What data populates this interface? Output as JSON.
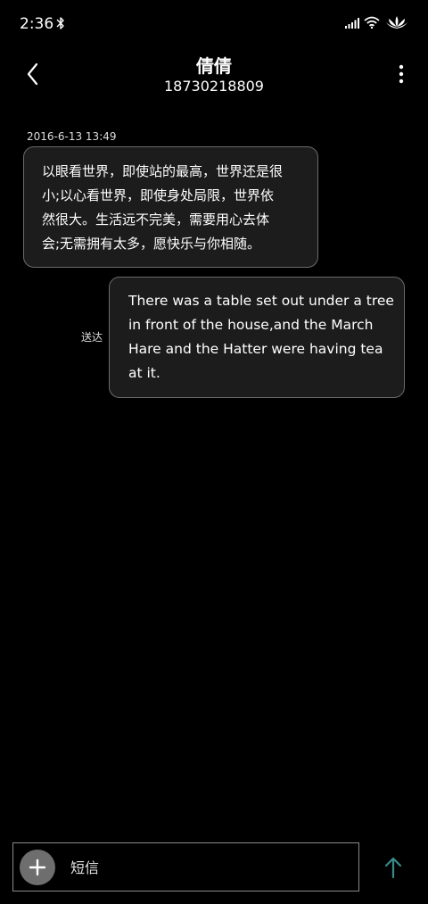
{
  "status_bar": {
    "time": "2:36",
    "icons": [
      "bluetooth-icon",
      "signal-icon",
      "wifi-icon",
      "lotus-icon"
    ]
  },
  "header": {
    "contact_name": "倩倩",
    "contact_number": "18730218809",
    "back_icon": "chevron-left-icon",
    "more_icon": "more-vertical-icon"
  },
  "conversation": {
    "timestamp": "2016-6-13 13:49",
    "messages": [
      {
        "direction": "incoming",
        "text": "以眼看世界，即使站的最高，世界还是很\n小;以心看世界，即使身处局限，世界依\n然很大。生活远不完美，需要用心去体\n会;无需拥有太多，愿快乐与你相随。"
      },
      {
        "direction": "outgoing",
        "text": "There was a table set out under a tree\nin front of the house,and the March\nHare and the Hatter were having tea\nat it.",
        "status": "送达"
      }
    ]
  },
  "composer": {
    "placeholder": "短信",
    "value": "",
    "add_icon": "plus-icon",
    "send_icon": "arrow-up-icon"
  },
  "colors": {
    "background": "#000000",
    "bubble_fill": "#1c1c1c",
    "bubble_border": "#6b6b6b",
    "send_accent": "#3a8a8a",
    "add_button": "#6e6e6e"
  }
}
